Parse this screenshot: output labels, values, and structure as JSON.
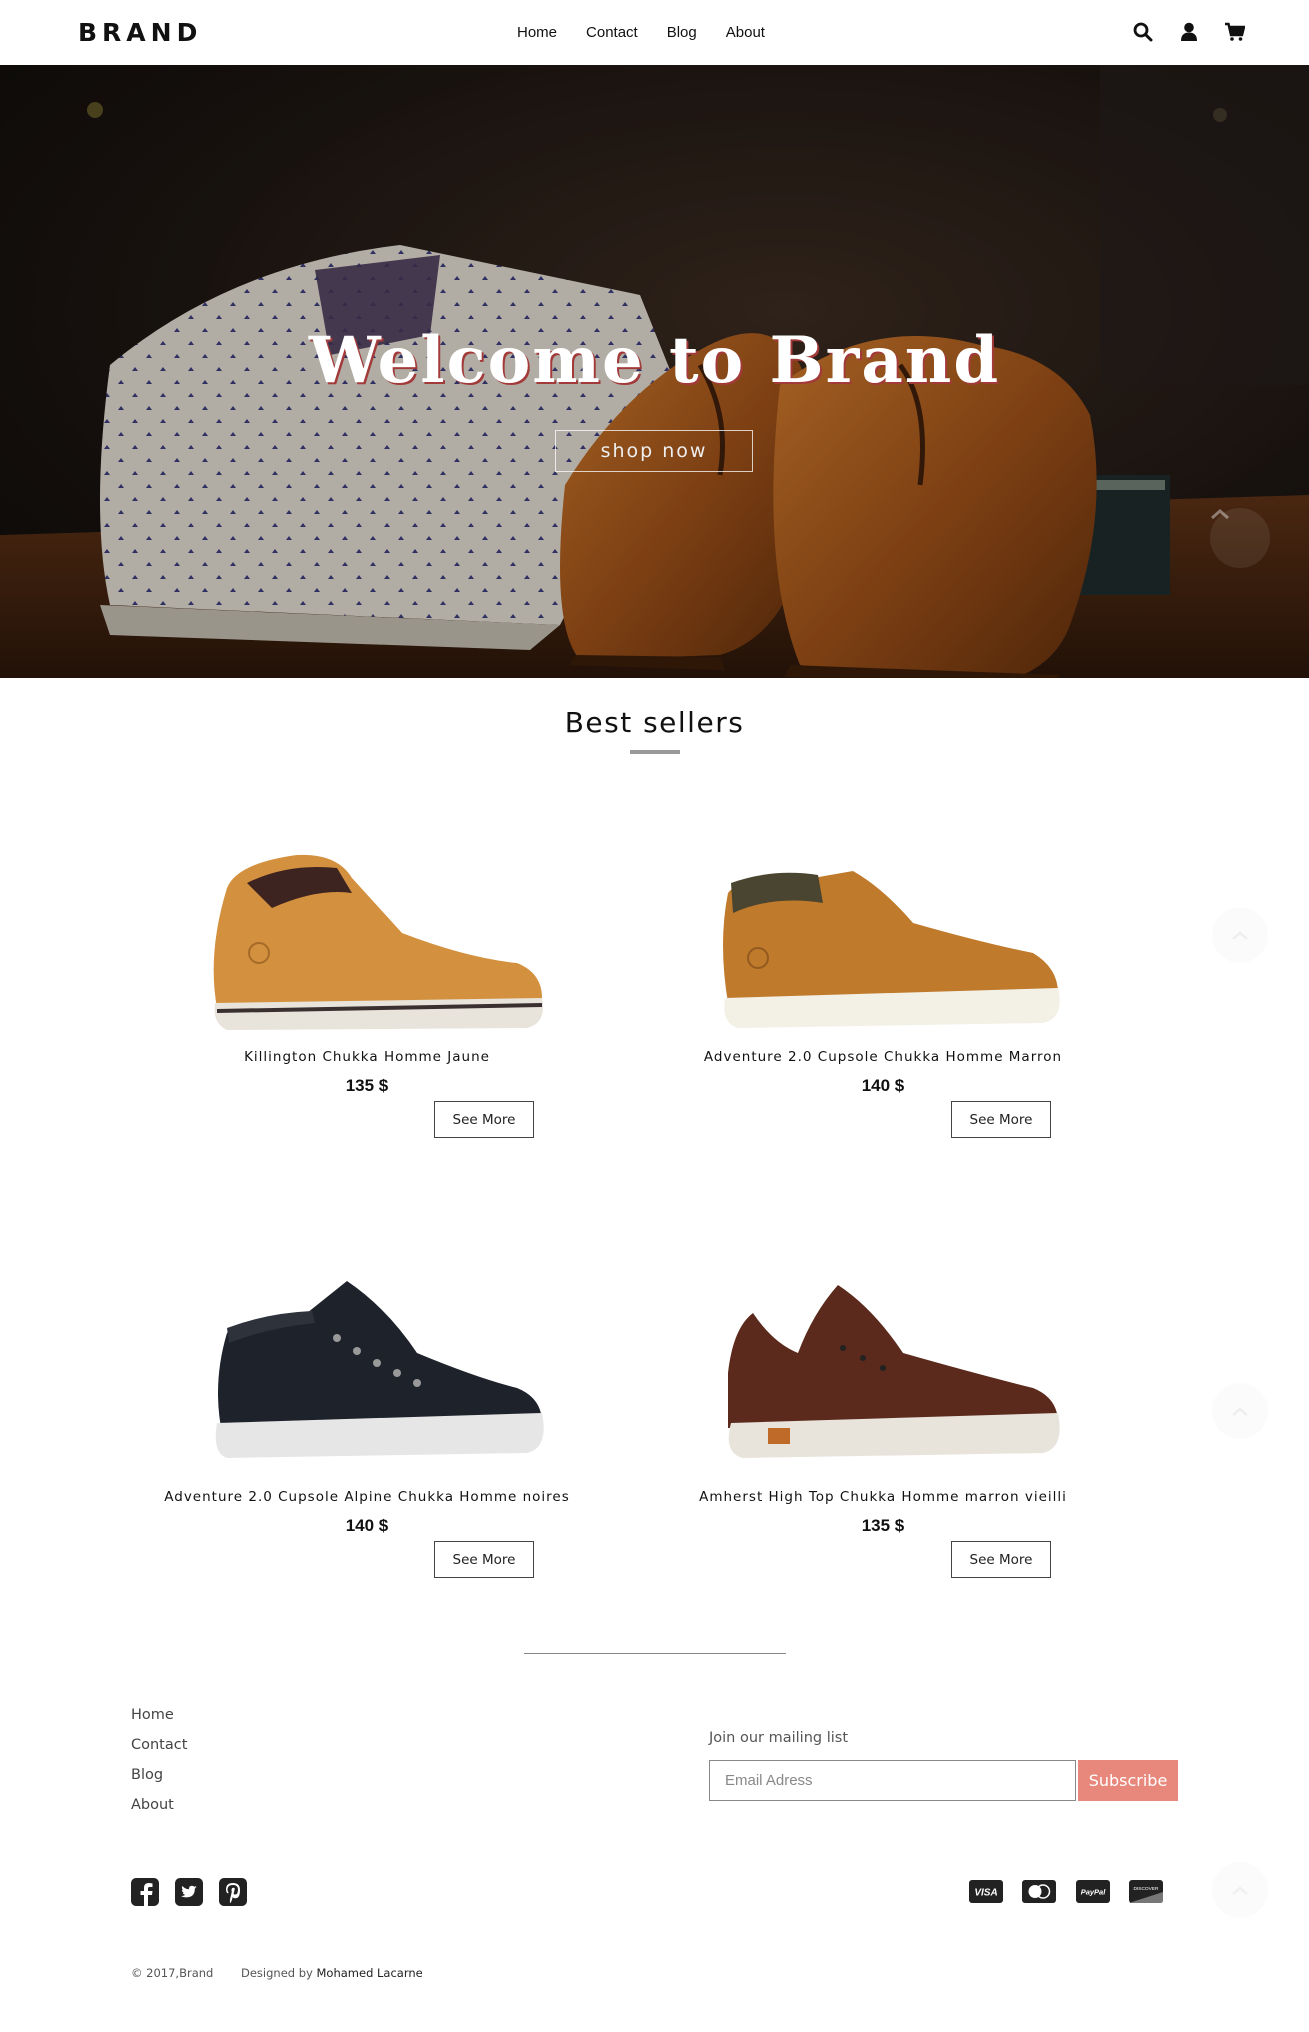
{
  "navbar": {
    "brand": "BRAND",
    "links": [
      "Home",
      "Contact",
      "Blog",
      "About"
    ],
    "icons": [
      "search-icon",
      "user-icon",
      "cart-icon"
    ]
  },
  "hero": {
    "title": "Welcome to Brand",
    "button": "shop now"
  },
  "best_sellers": {
    "title": "Best sellers",
    "products": [
      {
        "name": "Killington Chukka Homme Jaune",
        "price": "135 $",
        "button": "See More",
        "image": "tan-boot"
      },
      {
        "name": "Adventure 2.0 Cupsole Chukka Homme Marron",
        "price": "140 $",
        "button": "See More",
        "image": "brown-chukka"
      },
      {
        "name": "Adventure 2.0 Cupsole Alpine Chukka Homme noires",
        "price": "140 $",
        "button": "See More",
        "image": "black-chukka"
      },
      {
        "name": "Amherst High Top Chukka Homme marron vieilli",
        "price": "135 $",
        "button": "See More",
        "image": "dark-brown-sneaker"
      }
    ]
  },
  "footer": {
    "links": [
      "Home",
      "Contact",
      "Blog",
      "About"
    ],
    "mailing_label": "Join our mailing list",
    "email_placeholder": "Email Adress",
    "subscribe": "Subscribe",
    "social_icons": [
      "facebook-icon",
      "twitter-icon",
      "pinterest-icon"
    ],
    "payment_icons": [
      "visa-icon",
      "mastercard-icon",
      "paypal-icon",
      "discover-icon"
    ],
    "payment_labels": [
      "VISA",
      "PayPal",
      "DISCOVER"
    ],
    "copyright": "© 2017,Brand",
    "designed_by": "Designed by",
    "designer": "Mohamed Lacarne"
  },
  "colors": {
    "subscribe": "#e8887c",
    "text": "#111111",
    "hero_title_shadow": "#a33a3a"
  }
}
